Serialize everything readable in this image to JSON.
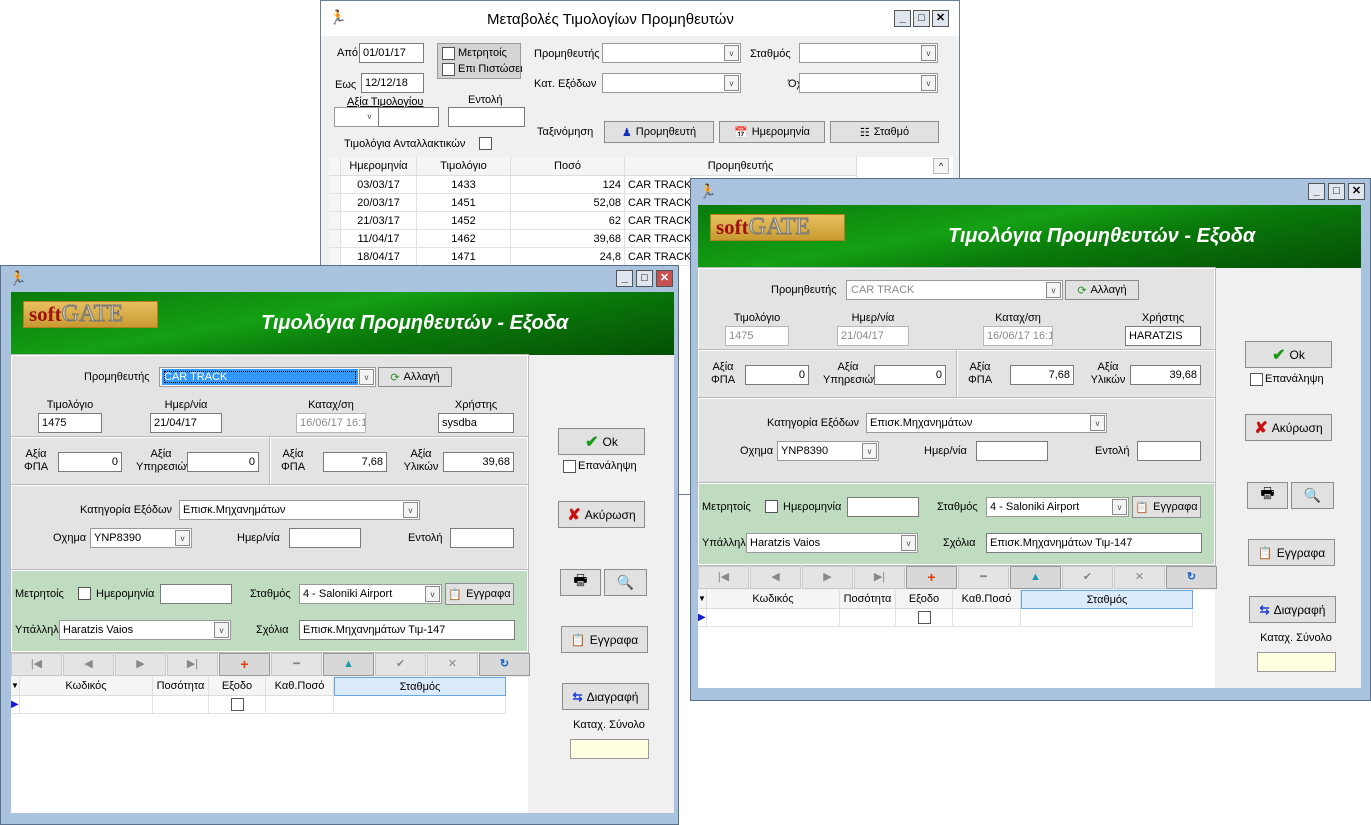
{
  "back_window": {
    "title": "Μεταβολές Τιμολογίων  Προμηθευτών",
    "from_label": "Από",
    "from_value": "01/01/17",
    "to_label": "Εως",
    "to_value": "12/12/18",
    "cash_label": "Μετρητοίς",
    "credit_label": "Επι Πιστώσει",
    "supplier_label": "Προμηθευτής",
    "supplier_value": "",
    "station_label": "Σταθμός",
    "station_value": "",
    "category_label": "Κατ. Εξόδων",
    "category_value": "",
    "vehicle_label": "Όχημα",
    "vehicle_value": "",
    "invoice_value_label": "Αξία Τιμολογίου",
    "invoice_value": "",
    "order_label": "Εντολή",
    "order_value": "",
    "parts_label": "Τιμολόγια Ανταλλακτικών",
    "sort_label": "Ταξινόμηση",
    "sort_buttons": [
      "Προμηθευτή",
      "Ημερομηνία",
      "Σταθμό"
    ],
    "columns": [
      "Ημερομηνία",
      "Τιμολόγιο",
      "Ποσό",
      "Προμηθευτής"
    ],
    "rows": [
      [
        "03/03/17",
        "1433",
        "124",
        "CAR TRACK"
      ],
      [
        "20/03/17",
        "1451",
        "52,08",
        "CAR TRACK"
      ],
      [
        "21/03/17",
        "1452",
        "62",
        "CAR TRACK"
      ],
      [
        "11/04/17",
        "1462",
        "39,68",
        "CAR TRACK"
      ],
      [
        "18/04/17",
        "1471",
        "24,8",
        "CAR TRACK"
      ]
    ]
  },
  "windows": {
    "left": {
      "title": "Τιμολόγια Προμηθευτών - Εξοδα",
      "logo_soft": "soft",
      "logo_gate": "GATE",
      "supplier_label": "Προμηθευτής",
      "supplier": "CAR TRACK",
      "change": "Αλλαγή",
      "invoice_label": "Τιμολόγιο",
      "invoice": "1475",
      "date_label": "Ημερ/νία",
      "date": "21/04/17",
      "reg_label": "Καταχ/ση",
      "reg": "16/06/17 16:1",
      "user_label": "Χρήστης",
      "user": "sysdba",
      "value_label": "Αξία",
      "vat_label": "ΦΠΑ",
      "services_label": "Υπηρεσιών",
      "materials_label": "Υλικών",
      "vat1": "0",
      "services": "0",
      "vat2": "7,68",
      "materials": "39,68",
      "category_label": "Κατηγορία Εξόδων",
      "category": "Επισκ.Μηχανημάτων",
      "vehicle_label": "Οχημα",
      "vehicle": "YNP8390",
      "date2_label": "Ημερ/νία",
      "date2": "",
      "order_label": "Εντολή",
      "order": "",
      "cash_label": "Μετρητοίς",
      "date3_label": "Ημερομηνία",
      "date3": "",
      "station_label": "Σταθμός",
      "station": "4 -  Saloniki Airport",
      "docs_small": "Εγγραφα",
      "employee_label": "Υπάλληλος",
      "employee": "Haratzis Vaios",
      "notes_label": "Σχόλια",
      "notes": "Επισκ.Μηχανημάτων Τιμ-147",
      "columns": [
        "Κωδικός",
        "Ποσότητα",
        "Εξοδο",
        "Καθ.Ποσό",
        "Σταθμός"
      ],
      "ok": "Ok",
      "repeat": "Επανάληψη",
      "cancel": "Ακύρωση",
      "docs": "Εγγραφα",
      "delete": "Διαγραφή",
      "total_label": "Καταχ. Σύνολο",
      "total": ""
    },
    "right": {
      "title": "Τιμολόγια Προμηθευτών - Εξοδα",
      "logo_soft": "soft",
      "logo_gate": "GATE",
      "supplier_label": "Προμηθευτής",
      "supplier": "CAR TRACK",
      "change": "Αλλαγή",
      "invoice_label": "Τιμολόγιο",
      "invoice": "1475",
      "date_label": "Ημερ/νία",
      "date": "21/04/17",
      "reg_label": "Καταχ/ση",
      "reg": "16/06/17 16:1",
      "user_label": "Χρήστης",
      "user": "HARATZIS",
      "value_label": "Αξία",
      "vat_label": "ΦΠΑ",
      "services_label": "Υπηρεσιών",
      "materials_label": "Υλικών",
      "vat1": "0",
      "services": "0",
      "vat2": "7,68",
      "materials": "39,68",
      "category_label": "Κατηγορία Εξόδων",
      "category": "Επισκ.Μηχανημάτων",
      "vehicle_label": "Οχημα",
      "vehicle": "YNP8390",
      "date2_label": "Ημερ/νία",
      "date2": "",
      "order_label": "Εντολή",
      "order": "",
      "cash_label": "Μετρητοίς",
      "date3_label": "Ημερομηνία",
      "date3": "",
      "station_label": "Σταθμός",
      "station": "4 -  Saloniki Airport",
      "docs_small": "Εγγραφα",
      "employee_label": "Υπάλληλος",
      "employee": "Haratzis Vaios",
      "notes_label": "Σχόλια",
      "notes": "Επισκ.Μηχανημάτων Τιμ-147",
      "columns": [
        "Κωδικός",
        "Ποσότητα",
        "Εξοδο",
        "Καθ.Ποσό",
        "Σταθμός"
      ],
      "ok": "Ok",
      "repeat": "Επανάληψη",
      "cancel": "Ακύρωση",
      "docs": "Εγγραφα",
      "delete": "Διαγραφή",
      "total_label": "Καταχ. Σύνολο",
      "total": ""
    }
  },
  "colors": {
    "header_green": "#0b7a0b",
    "filter_panel_green": "#c0dcc0",
    "selection_blue": "#3399ff",
    "total_yellow": "#ffffe1"
  }
}
